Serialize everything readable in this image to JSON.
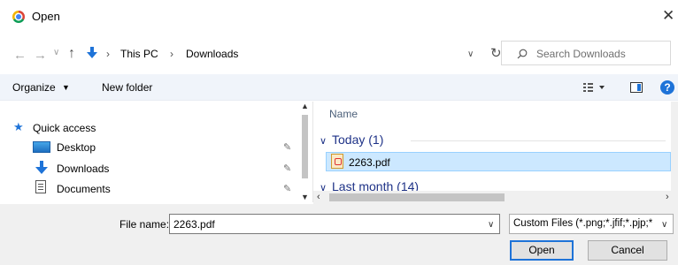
{
  "window": {
    "title": "Open",
    "close_glyph": "✕"
  },
  "nav": {
    "back": "←",
    "forward": "→",
    "recent": "∨",
    "up": "↑"
  },
  "address": {
    "crumbs": [
      "This PC",
      "Downloads"
    ],
    "separator": "›",
    "dropdown": "∨",
    "refresh": "↻"
  },
  "search": {
    "placeholder": "Search Downloads"
  },
  "toolbar": {
    "organize": "Organize",
    "organize_caret": "▼",
    "new_folder": "New folder",
    "help": "?"
  },
  "sidebar": {
    "items": [
      {
        "label": "Quick access",
        "icon": "star-icon"
      },
      {
        "label": "Desktop",
        "icon": "desktop-icon",
        "pinned": true
      },
      {
        "label": "Downloads",
        "icon": "downloads-icon",
        "pinned": true
      },
      {
        "label": "Documents",
        "icon": "documents-icon",
        "pinned": true
      }
    ],
    "pin_glyph": "📌"
  },
  "files": {
    "column_header": "Name",
    "groups": [
      {
        "label": "Today (1)",
        "files": [
          "2263.pdf"
        ]
      },
      {
        "label": "Last month (14)"
      }
    ],
    "caret": "∨"
  },
  "bottom": {
    "filename_label": "File name:",
    "filename_value": "2263.pdf",
    "filter_value": "Custom Files (*.png;*.jfif;*.pjp;*",
    "open_label": "Open",
    "cancel_label": "Cancel",
    "dropdown_glyph": "∨"
  },
  "colors": {
    "accent": "#1e73d8",
    "selection": "#cce8ff",
    "group_text": "#1e3287"
  }
}
